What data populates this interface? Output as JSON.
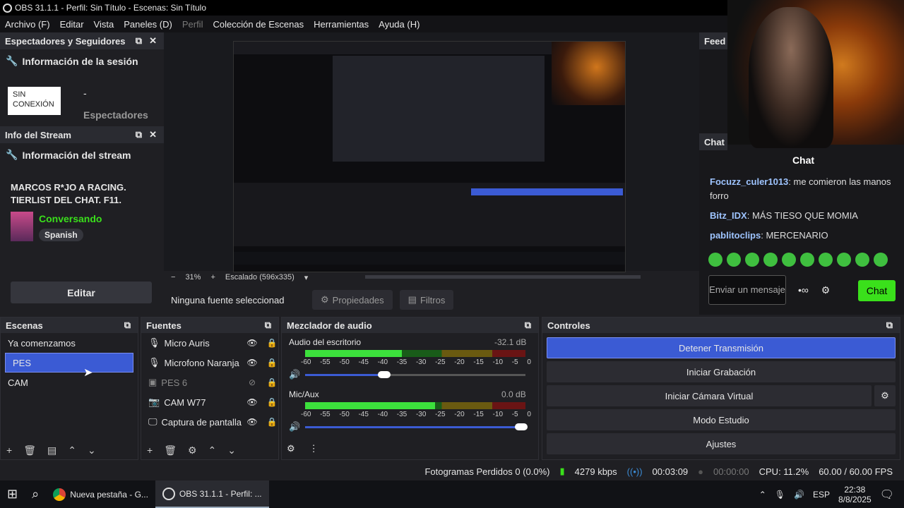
{
  "window": {
    "title": "OBS 31.1.1 - Perfil: Sin Título - Escenas: Sin Título"
  },
  "menu": [
    "Archivo (F)",
    "Editar",
    "Vista",
    "Paneles (D)",
    "Perfil",
    "Colección de Escenas",
    "Herramientas",
    "Ayuda (H)"
  ],
  "viewers_dock": {
    "title": "Espectadores y Seguidores",
    "section": "Información de la sesión",
    "status": "SIN CONEXIÓN",
    "count": "-",
    "count_label": "Espectadores"
  },
  "stream_dock": {
    "title": "Info del Stream",
    "section": "Información del stream",
    "stream_title": "MARCOS R*JO A RACING. TIERLIST DEL CHAT. F11.",
    "category": "Conversando",
    "language": "Spanish",
    "edit_label": "Editar"
  },
  "preview": {
    "zoom": "31%",
    "scale_label": "Escalado (596x335)"
  },
  "source_bar": {
    "no_source": "Ninguna fuente seleccionad",
    "properties": "Propiedades",
    "filters": "Filtros"
  },
  "chat": {
    "feed_label": "Feed",
    "dock_label": "Chat",
    "title": "Chat",
    "messages": [
      {
        "user": "Focuzz_culer1013",
        "text": "me comieron las manos forro"
      },
      {
        "user": "Bitz_IDX",
        "text": "MÁS TIESO QUE MOMIA"
      },
      {
        "user": "pablitoclips",
        "text": "MERCENARIO"
      }
    ],
    "placeholder": "Enviar un mensaje",
    "send": "Chat",
    "accent": "#3ae01b"
  },
  "scenes": {
    "title": "Escenas",
    "items": [
      "Ya comenzamos",
      "PES",
      "CAM"
    ],
    "selected": "PES"
  },
  "sources": {
    "title": "Fuentes",
    "items": [
      {
        "name": "Micro Auris",
        "icon": "mic-icon"
      },
      {
        "name": "Microfono Naranja",
        "icon": "mic-icon"
      },
      {
        "name": "PES 6",
        "icon": "image-icon",
        "hidden": true
      },
      {
        "name": "CAM W77",
        "icon": "camera-icon"
      },
      {
        "name": "Captura de pantalla",
        "icon": "monitor-icon"
      }
    ]
  },
  "mixer": {
    "title": "Mezclador de audio",
    "channels": [
      {
        "name": "Audio del escritorio",
        "db": "-32.1 dB",
        "level": 0.44,
        "volume": 0.36
      },
      {
        "name": "Mic/Aux",
        "db": "0.0 dB",
        "level": 0.59,
        "volume": 0.98
      }
    ],
    "scale": [
      "-60",
      "-55",
      "-50",
      "-45",
      "-40",
      "-35",
      "-30",
      "-25",
      "-20",
      "-15",
      "-10",
      "-5",
      "0"
    ]
  },
  "controls": {
    "title": "Controles",
    "buttons": [
      "Detener Transmisión",
      "Iniciar Grabación",
      "Iniciar Cámara Virtual",
      "Modo Estudio",
      "Ajustes"
    ]
  },
  "status": {
    "dropped": "Fotogramas Perdidos 0 (0.0%)",
    "bitrate": "4279 kbps",
    "stream_time": "00:03:09",
    "rec_time": "00:00:00",
    "cpu": "CPU: 11.2%",
    "fps": "60.00 / 60.00 FPS"
  },
  "taskbar": {
    "items": [
      "Nueva pestaña - G...",
      "OBS 31.1.1 - Perfil: ..."
    ],
    "lang": "ESP",
    "time": "22:38",
    "date": "8/8/2025"
  }
}
